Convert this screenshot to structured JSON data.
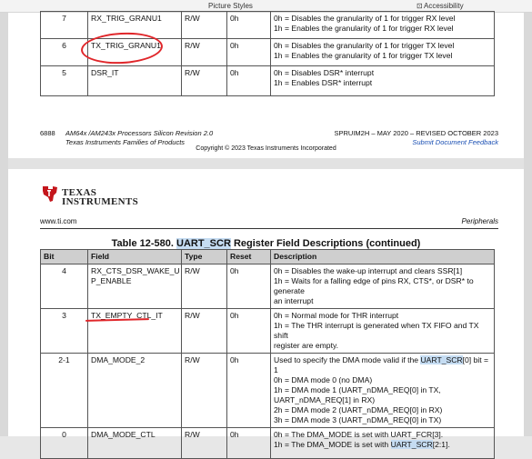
{
  "ribbon": {
    "picture_styles": "Picture Styles",
    "accessibility": "Accessibility"
  },
  "table_top": {
    "rows": [
      {
        "bit": "7",
        "field": "RX_TRIG_GRANU1",
        "type": "R/W",
        "reset": "0h",
        "desc": [
          "0h = Disables the granularity of 1 for trigger RX level",
          "1h = Enables the granularity of 1 for trigger RX level"
        ]
      },
      {
        "bit": "6",
        "field": "TX_TRIG_GRANU1",
        "type": "R/W",
        "reset": "0h",
        "desc": [
          "0h = Disables the granularity of 1 for trigger TX level",
          "1h = Enables the granularity of 1 for trigger TX level"
        ]
      },
      {
        "bit": "5",
        "field": "DSR_IT",
        "type": "R/W",
        "reset": "0h",
        "desc": [
          "0h = Disables DSR* interrupt",
          "1h = Enables DSR* interrupt"
        ]
      }
    ]
  },
  "footer": {
    "page_number": "6888",
    "doc_title": "AM64x /AM243x Processors Silicon Revision 2.0",
    "doc_subtitle": "Texas Instruments Families of Products",
    "doc_id": "SPRUIM2H – MAY 2020 – REVISED OCTOBER 2023",
    "feedback_link": "Submit Document Feedback",
    "copyright": "Copyright © 2023 Texas Instruments Incorporated"
  },
  "header": {
    "logo_line1": "TEXAS",
    "logo_line2": "INSTRUMENTS",
    "site": "www.ti.com",
    "section": "Peripherals"
  },
  "table_caption": {
    "prefix": "Table 12-580. ",
    "reg": "UART_SCR",
    "suffix": " Register Field Descriptions (continued)"
  },
  "table_bot": {
    "headers": [
      "Bit",
      "Field",
      "Type",
      "Reset",
      "Description"
    ],
    "rows": [
      {
        "bit": "4",
        "field": [
          "RX_CTS_DSR_WAKE_U",
          "P_ENABLE"
        ],
        "type": "R/W",
        "reset": "0h",
        "desc": [
          "0h = Disables the wake-up interrupt and clears SSR[1]",
          "1h = Waits for a falling edge of pins RX, CTS*, or DSR* to generate",
          "an interrupt"
        ]
      },
      {
        "bit": "3",
        "field": [
          "TX_EMPTY_CTL_IT"
        ],
        "type": "R/W",
        "reset": "0h",
        "desc": [
          "0h = Normal mode for THR interrupt",
          "1h = The THR interrupt is generated when TX FIFO and TX shift",
          "register are empty."
        ]
      },
      {
        "bit": "2-1",
        "field": [
          "DMA_MODE_2"
        ],
        "type": "R/W",
        "reset": "0h",
        "desc_first_pre": "Used to specify the DMA mode valid if the ",
        "desc_first_hl": "UART_SCR",
        "desc_first_post": "[0] bit = 1",
        "desc": [
          "0h = DMA mode 0 (no DMA)",
          "1h = DMA mode 1 (UART_nDMA_REQ[0] in TX,",
          "UART_nDMA_REQ[1] in RX)",
          "2h = DMA mode 2 (UART_nDMA_REQ[0] in RX)",
          "3h = DMA mode 3 (UART_nDMA_REQ[0] in TX)"
        ]
      },
      {
        "bit": "0",
        "field": [
          "DMA_MODE_CTL"
        ],
        "type": "R/W",
        "reset": "0h",
        "desc": [
          "0h = The DMA_MODE is set with UART_FCR[3]."
        ],
        "desc_last_pre": "1h = The DMA_MODE is set with ",
        "desc_last_hl": "UART_SCR",
        "desc_last_post": "[2:1]."
      }
    ]
  }
}
